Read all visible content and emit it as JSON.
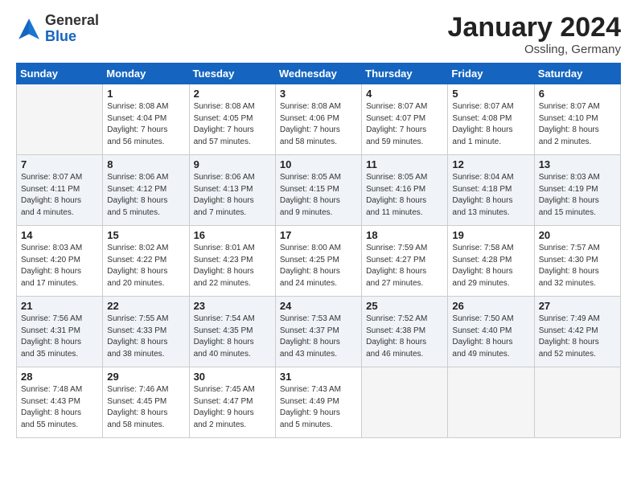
{
  "header": {
    "logo_general": "General",
    "logo_blue": "Blue",
    "title": "January 2024",
    "subtitle": "Ossling, Germany"
  },
  "weekdays": [
    "Sunday",
    "Monday",
    "Tuesday",
    "Wednesday",
    "Thursday",
    "Friday",
    "Saturday"
  ],
  "weeks": [
    [
      {
        "day": "",
        "info": ""
      },
      {
        "day": "1",
        "info": "Sunrise: 8:08 AM\nSunset: 4:04 PM\nDaylight: 7 hours\nand 56 minutes."
      },
      {
        "day": "2",
        "info": "Sunrise: 8:08 AM\nSunset: 4:05 PM\nDaylight: 7 hours\nand 57 minutes."
      },
      {
        "day": "3",
        "info": "Sunrise: 8:08 AM\nSunset: 4:06 PM\nDaylight: 7 hours\nand 58 minutes."
      },
      {
        "day": "4",
        "info": "Sunrise: 8:07 AM\nSunset: 4:07 PM\nDaylight: 7 hours\nand 59 minutes."
      },
      {
        "day": "5",
        "info": "Sunrise: 8:07 AM\nSunset: 4:08 PM\nDaylight: 8 hours\nand 1 minute."
      },
      {
        "day": "6",
        "info": "Sunrise: 8:07 AM\nSunset: 4:10 PM\nDaylight: 8 hours\nand 2 minutes."
      }
    ],
    [
      {
        "day": "7",
        "info": "Sunrise: 8:07 AM\nSunset: 4:11 PM\nDaylight: 8 hours\nand 4 minutes."
      },
      {
        "day": "8",
        "info": "Sunrise: 8:06 AM\nSunset: 4:12 PM\nDaylight: 8 hours\nand 5 minutes."
      },
      {
        "day": "9",
        "info": "Sunrise: 8:06 AM\nSunset: 4:13 PM\nDaylight: 8 hours\nand 7 minutes."
      },
      {
        "day": "10",
        "info": "Sunrise: 8:05 AM\nSunset: 4:15 PM\nDaylight: 8 hours\nand 9 minutes."
      },
      {
        "day": "11",
        "info": "Sunrise: 8:05 AM\nSunset: 4:16 PM\nDaylight: 8 hours\nand 11 minutes."
      },
      {
        "day": "12",
        "info": "Sunrise: 8:04 AM\nSunset: 4:18 PM\nDaylight: 8 hours\nand 13 minutes."
      },
      {
        "day": "13",
        "info": "Sunrise: 8:03 AM\nSunset: 4:19 PM\nDaylight: 8 hours\nand 15 minutes."
      }
    ],
    [
      {
        "day": "14",
        "info": "Sunrise: 8:03 AM\nSunset: 4:20 PM\nDaylight: 8 hours\nand 17 minutes."
      },
      {
        "day": "15",
        "info": "Sunrise: 8:02 AM\nSunset: 4:22 PM\nDaylight: 8 hours\nand 20 minutes."
      },
      {
        "day": "16",
        "info": "Sunrise: 8:01 AM\nSunset: 4:23 PM\nDaylight: 8 hours\nand 22 minutes."
      },
      {
        "day": "17",
        "info": "Sunrise: 8:00 AM\nSunset: 4:25 PM\nDaylight: 8 hours\nand 24 minutes."
      },
      {
        "day": "18",
        "info": "Sunrise: 7:59 AM\nSunset: 4:27 PM\nDaylight: 8 hours\nand 27 minutes."
      },
      {
        "day": "19",
        "info": "Sunrise: 7:58 AM\nSunset: 4:28 PM\nDaylight: 8 hours\nand 29 minutes."
      },
      {
        "day": "20",
        "info": "Sunrise: 7:57 AM\nSunset: 4:30 PM\nDaylight: 8 hours\nand 32 minutes."
      }
    ],
    [
      {
        "day": "21",
        "info": "Sunrise: 7:56 AM\nSunset: 4:31 PM\nDaylight: 8 hours\nand 35 minutes."
      },
      {
        "day": "22",
        "info": "Sunrise: 7:55 AM\nSunset: 4:33 PM\nDaylight: 8 hours\nand 38 minutes."
      },
      {
        "day": "23",
        "info": "Sunrise: 7:54 AM\nSunset: 4:35 PM\nDaylight: 8 hours\nand 40 minutes."
      },
      {
        "day": "24",
        "info": "Sunrise: 7:53 AM\nSunset: 4:37 PM\nDaylight: 8 hours\nand 43 minutes."
      },
      {
        "day": "25",
        "info": "Sunrise: 7:52 AM\nSunset: 4:38 PM\nDaylight: 8 hours\nand 46 minutes."
      },
      {
        "day": "26",
        "info": "Sunrise: 7:50 AM\nSunset: 4:40 PM\nDaylight: 8 hours\nand 49 minutes."
      },
      {
        "day": "27",
        "info": "Sunrise: 7:49 AM\nSunset: 4:42 PM\nDaylight: 8 hours\nand 52 minutes."
      }
    ],
    [
      {
        "day": "28",
        "info": "Sunrise: 7:48 AM\nSunset: 4:43 PM\nDaylight: 8 hours\nand 55 minutes."
      },
      {
        "day": "29",
        "info": "Sunrise: 7:46 AM\nSunset: 4:45 PM\nDaylight: 8 hours\nand 58 minutes."
      },
      {
        "day": "30",
        "info": "Sunrise: 7:45 AM\nSunset: 4:47 PM\nDaylight: 9 hours\nand 2 minutes."
      },
      {
        "day": "31",
        "info": "Sunrise: 7:43 AM\nSunset: 4:49 PM\nDaylight: 9 hours\nand 5 minutes."
      },
      {
        "day": "",
        "info": ""
      },
      {
        "day": "",
        "info": ""
      },
      {
        "day": "",
        "info": ""
      }
    ]
  ]
}
